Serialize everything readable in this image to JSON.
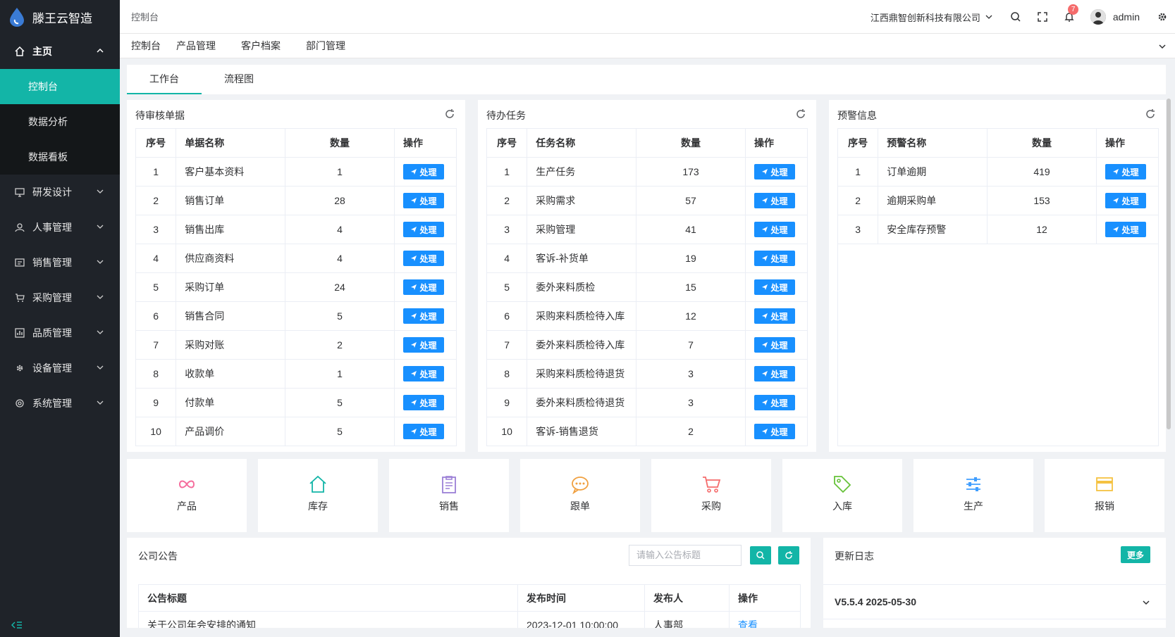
{
  "app": {
    "name": "滕王云智造"
  },
  "sidebar": {
    "main_label": "主页",
    "sub_items": [
      "控制台",
      "数据分析",
      "数据看板"
    ],
    "items": [
      {
        "label": "研发设计",
        "icon": "monitor-icon"
      },
      {
        "label": "人事管理",
        "icon": "user-icon"
      },
      {
        "label": "销售管理",
        "icon": "sales-icon"
      },
      {
        "label": "采购管理",
        "icon": "cart-icon"
      },
      {
        "label": "品质管理",
        "icon": "chart-icon"
      },
      {
        "label": "设备管理",
        "icon": "gear-icon"
      },
      {
        "label": "系统管理",
        "icon": "cog-icon"
      }
    ]
  },
  "header": {
    "breadcrumb": "控制台",
    "company": "江西鼎智创新科技有限公司",
    "notification_count": "7",
    "username": "admin"
  },
  "navtabs": [
    "控制台",
    "产品管理",
    "客户档案",
    "部门管理"
  ],
  "innertabs": [
    "工作台",
    "流程图"
  ],
  "action_label": "处理",
  "panels": {
    "pending": {
      "title": "待审核单据",
      "headers": [
        "序号",
        "单据名称",
        "数量",
        "操作"
      ],
      "rows": [
        [
          "1",
          "客户基本资料",
          "1"
        ],
        [
          "2",
          "销售订单",
          "28"
        ],
        [
          "3",
          "销售出库",
          "4"
        ],
        [
          "4",
          "供应商资料",
          "4"
        ],
        [
          "5",
          "采购订单",
          "24"
        ],
        [
          "6",
          "销售合同",
          "5"
        ],
        [
          "7",
          "采购对账",
          "2"
        ],
        [
          "8",
          "收款单",
          "1"
        ],
        [
          "9",
          "付款单",
          "5"
        ],
        [
          "10",
          "产品调价",
          "5"
        ]
      ]
    },
    "tasks": {
      "title": "待办任务",
      "headers": [
        "序号",
        "任务名称",
        "数量",
        "操作"
      ],
      "rows": [
        [
          "1",
          "生产任务",
          "173"
        ],
        [
          "2",
          "采购需求",
          "57"
        ],
        [
          "3",
          "采购管理",
          "41"
        ],
        [
          "4",
          "客诉-补货单",
          "19"
        ],
        [
          "5",
          "委外来料质检",
          "15"
        ],
        [
          "6",
          "采购来料质检待入库",
          "12"
        ],
        [
          "7",
          "委外来料质检待入库",
          "7"
        ],
        [
          "8",
          "采购来料质检待退货",
          "3"
        ],
        [
          "9",
          "委外来料质检待退货",
          "3"
        ],
        [
          "10",
          "客诉-销售退货",
          "2"
        ]
      ]
    },
    "alerts": {
      "title": "预警信息",
      "headers": [
        "序号",
        "预警名称",
        "数量",
        "操作"
      ],
      "rows": [
        [
          "1",
          "订单逾期",
          "419"
        ],
        [
          "2",
          "逾期采购单",
          "153"
        ],
        [
          "3",
          "安全库存预警",
          "12"
        ]
      ]
    }
  },
  "shortcuts": [
    {
      "label": "产品",
      "icon": "infinity-icon",
      "color": "#f56c9c"
    },
    {
      "label": "库存",
      "icon": "home-icon",
      "color": "#13b5a7"
    },
    {
      "label": "销售",
      "icon": "clipboard-icon",
      "color": "#9b7fd6"
    },
    {
      "label": "跟单",
      "icon": "chat-icon",
      "color": "#f0a040"
    },
    {
      "label": "采购",
      "icon": "cart-icon",
      "color": "#f56c6c"
    },
    {
      "label": "入库",
      "icon": "tag-icon",
      "color": "#67c23a"
    },
    {
      "label": "生产",
      "icon": "sliders-icon",
      "color": "#409eff"
    },
    {
      "label": "报销",
      "icon": "card-icon",
      "color": "#f5c242"
    }
  ],
  "notices": {
    "title": "公司公告",
    "search_placeholder": "请输入公告标题",
    "headers": [
      "公告标题",
      "发布时间",
      "发布人",
      "操作"
    ],
    "rows": [
      [
        "关于公司年会安排的通知",
        "2023-12-01 10:00:00",
        "人事部",
        "查看"
      ]
    ]
  },
  "changelog": {
    "title": "更新日志",
    "more_label": "更多",
    "version": "V5.5.4 2025-05-30"
  }
}
